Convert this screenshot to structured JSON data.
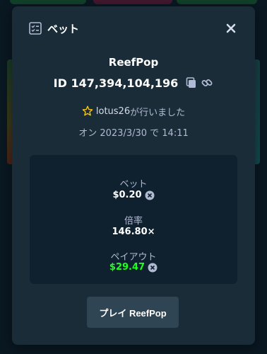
{
  "modal": {
    "title": "ベット",
    "icon": "list-check-icon",
    "close_icon": "close-icon"
  },
  "bet": {
    "game": "ReefPop",
    "id": "ID 147,394,104,196",
    "copy_icon": "copy-icon",
    "link_icon": "link-icon"
  },
  "player": {
    "name": "lotus26",
    "suffix": "が行いました",
    "vip_icon": "star-icon",
    "vip_color": "#f5c518"
  },
  "date": "オン 2023/3/30 で 14:11",
  "stats": {
    "bet_label": "ベット",
    "bet_value": "$0.20",
    "multiplier_label": "倍率",
    "multiplier_value": "146.80×",
    "payout_label": "ペイアウト",
    "payout_value": "$29.47",
    "payout_color": "#1fff20",
    "currency_icon": "currency-coin-icon"
  },
  "play_button": "プレイ ReefPop"
}
